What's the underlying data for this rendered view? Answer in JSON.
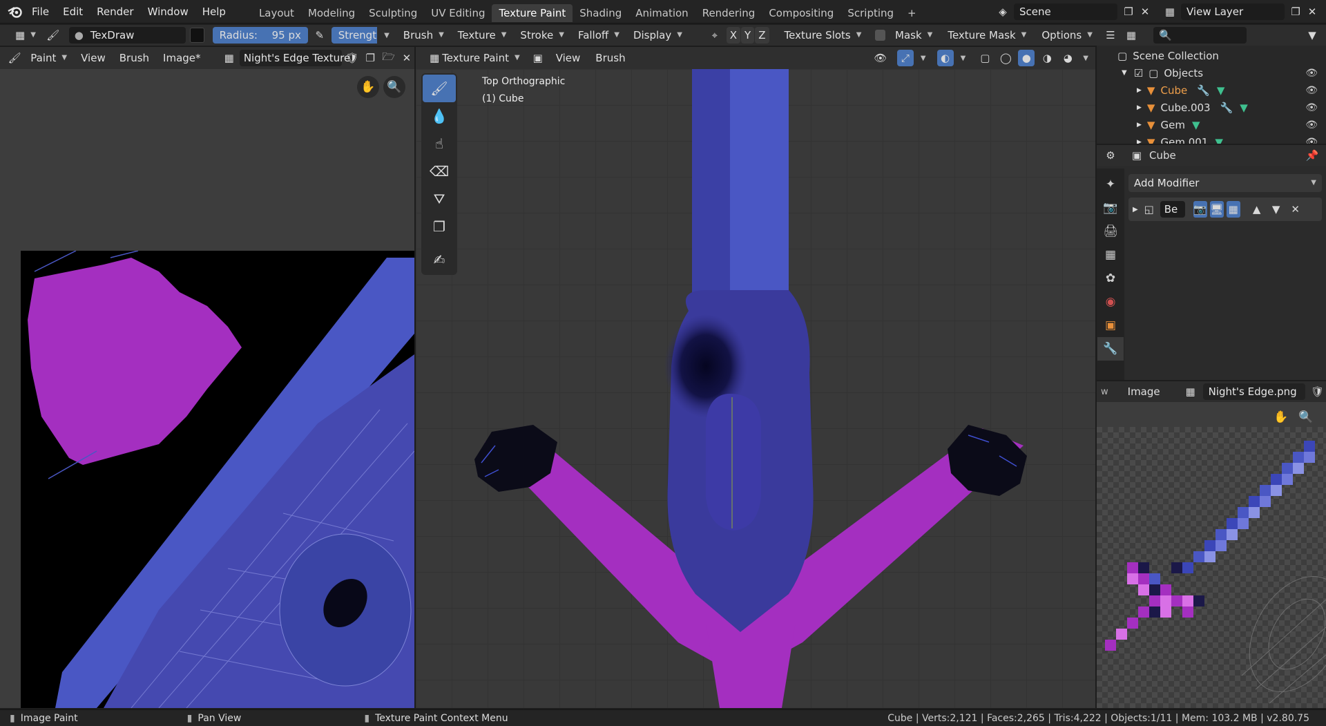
{
  "topbar": {
    "menus": [
      "File",
      "Edit",
      "Render",
      "Window",
      "Help"
    ],
    "workspaces": [
      "Layout",
      "Modeling",
      "Sculpting",
      "UV Editing",
      "Texture Paint",
      "Shading",
      "Animation",
      "Rendering",
      "Compositing",
      "Scripting"
    ],
    "active_workspace": "Texture Paint",
    "add_tab": "+",
    "scene_name": "Scene",
    "view_layer": "View Layer"
  },
  "tool_header": {
    "brush_name": "TexDraw",
    "radius_label": "Radius:",
    "radius_value": "95 px",
    "strength_label": "Strength:",
    "menus": [
      "Brush",
      "Texture",
      "Stroke",
      "Falloff",
      "Display"
    ],
    "axes": [
      "X",
      "Y",
      "Z"
    ],
    "texture_slots": "Texture Slots",
    "mask": "Mask",
    "texture_mask": "Texture Mask",
    "options": "Options"
  },
  "image_editor": {
    "mode": "Paint",
    "menus": [
      "View",
      "Brush",
      "Image*"
    ],
    "image_name": "Night's Edge Texture"
  },
  "viewport": {
    "mode": "Texture Paint",
    "menus": [
      "View",
      "Brush"
    ],
    "view_name": "Top Orthographic",
    "object_label": "(1) Cube"
  },
  "outliner": {
    "search_placeholder": "",
    "root": "Scene Collection",
    "collection": "Objects",
    "items": [
      "Cube",
      "Cube.003",
      "Gem",
      "Gem.001"
    ]
  },
  "properties": {
    "object_name": "Cube",
    "add_modifier": "Add Modifier",
    "modifier_name": "Be"
  },
  "image_panel": {
    "label": "Image",
    "image_name": "Night's Edge.png"
  },
  "statusbar": {
    "left_action": "Image Paint",
    "mid_action": "Pan View",
    "context_action": "Texture Paint Context Menu",
    "stats": "Cube | Verts:2,121 | Faces:2,265 | Tris:4,222 | Objects:1/11 | Mem: 103.2 MB | v2.80.75"
  },
  "colors": {
    "accent": "#4772b3",
    "blade_blue": "#4a57c4",
    "hilt_purple": "#a42fc0",
    "dark_navy": "#1b1848",
    "active_object": "#f0a04b"
  },
  "icons": [
    "blender-logo-icon",
    "paint-brush-icon",
    "hand-icon",
    "zoom-icon",
    "eye-icon",
    "mesh-icon",
    "wrench-icon",
    "filter-icon",
    "search-icon",
    "pin-icon",
    "close-icon",
    "camera-icon",
    "monitor-icon"
  ]
}
